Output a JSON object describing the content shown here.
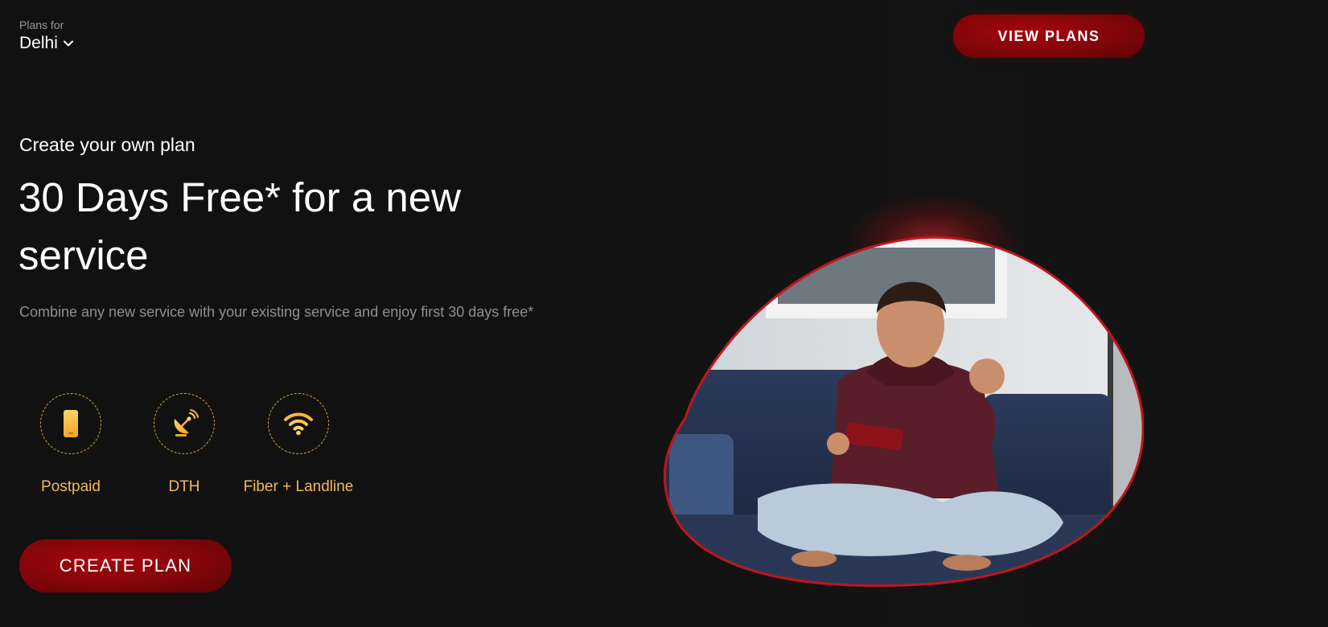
{
  "location": {
    "caption": "Plans for",
    "value": "Delhi"
  },
  "header": {
    "view_plans_label": "VIEW PLANS"
  },
  "hero": {
    "eyebrow": "Create your own plan",
    "headline": "30 Days Free* for a new service",
    "description": "Combine any new service with your existing service and enjoy first 30 days free*"
  },
  "services": [
    {
      "label": "Postpaid",
      "icon": "phone-icon"
    },
    {
      "label": "DTH",
      "icon": "satellite-dish-icon"
    },
    {
      "label": "Fiber + Landline",
      "icon": "wifi-icon"
    }
  ],
  "cta": {
    "create_plan_label": "CREATE PLAN"
  },
  "colors": {
    "background": "#111111",
    "brand_red": "#8b0509",
    "service_gold": "#f2b85a",
    "muted_text": "#8f8f8f"
  }
}
